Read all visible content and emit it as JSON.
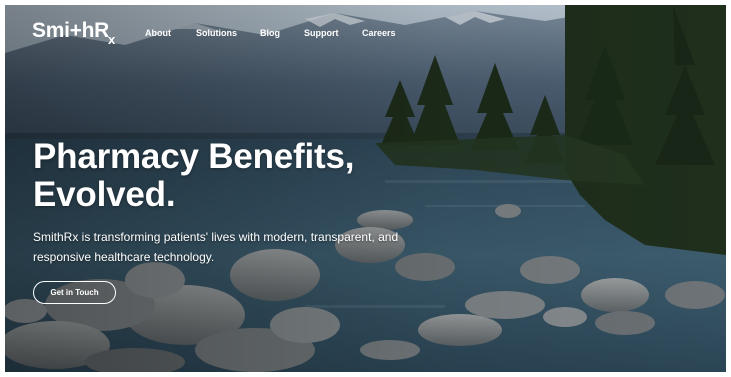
{
  "brand": {
    "logo_main": "Smi",
    "logo_mid": "+hR",
    "logo_sub": "x"
  },
  "nav": {
    "items": [
      {
        "label": "About"
      },
      {
        "label": "Solutions"
      },
      {
        "label": "Blog"
      },
      {
        "label": "Support"
      },
      {
        "label": "Careers"
      }
    ]
  },
  "hero": {
    "headline_line1": "Pharmacy Benefits,",
    "headline_line2": "Evolved.",
    "subtext": "SmithRx is transforming patients' lives with modern, transparent, and responsive healthcare technology.",
    "cta_label": "Get in Touch"
  },
  "colors": {
    "text": "#ffffff",
    "sky": "#c9d3dc",
    "mountain": "#5f7182",
    "water": "#3b5566",
    "forest": "#23331f",
    "rock": "#8a8f92"
  }
}
